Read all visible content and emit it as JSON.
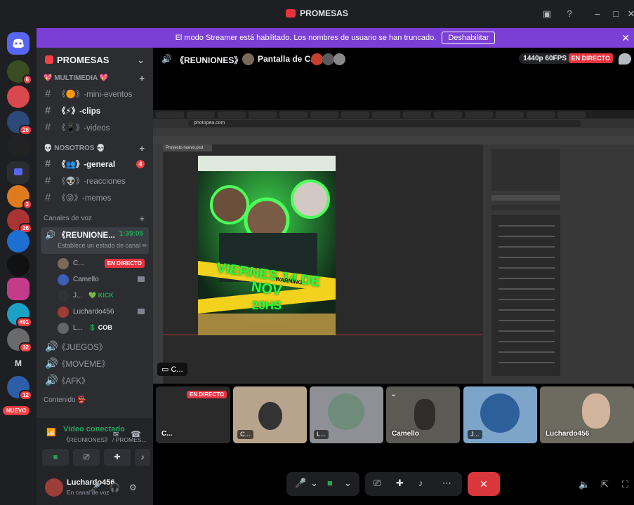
{
  "window": {
    "title": "PROMESAS"
  },
  "banner": {
    "text": "El modo Streamer está habilitado. Los nombres de usuario se han truncado.",
    "button": "Deshabilitar"
  },
  "servers": {
    "badges": [
      "6",
      "26",
      "3",
      "26",
      "491",
      "32",
      "12"
    ],
    "letter_server": "M",
    "new_label": "NUEVO"
  },
  "sidebar": {
    "guild_name": "PROMESAS",
    "categories": [
      {
        "label": "💖 MULTIMEDIA 💖",
        "channels": [
          {
            "name": "《🟠》-mini-eventos",
            "active": false
          },
          {
            "name": "《⚡》-clips",
            "active": true
          },
          {
            "name": "《📱》-videos",
            "active": false
          }
        ]
      },
      {
        "label": "💀 NOSOTROS 💀",
        "channels": [
          {
            "name": "《👥》-general",
            "active": true,
            "badge": "4"
          },
          {
            "name": "《👽》-reacciones",
            "active": false
          },
          {
            "name": "《😜》-memes",
            "active": false
          }
        ]
      }
    ],
    "voice_category": "Canales de voz",
    "voice_active": {
      "name": "《REUNIONE...",
      "time": "1:39:05",
      "status": "Establece un estado de canal ✏"
    },
    "voice_users": [
      {
        "name": "C...",
        "live": "EN DIRECTO"
      },
      {
        "name": "Camello"
      },
      {
        "name": "J...",
        "tag": "💚 KICK"
      },
      {
        "name": "Luchardo456"
      },
      {
        "name": "L...",
        "tag": "💲 COB"
      }
    ],
    "voice_channels": [
      "《JUEGOS》",
      "《MOVEME》",
      "《AFK》"
    ],
    "content_category": "Contenido 👺"
  },
  "rtc": {
    "status": "Video conectado",
    "channel": "《REUNIONES》 / PROMES...",
    "user": {
      "name": "Luchardo456",
      "status": "En canal de voz"
    }
  },
  "stage": {
    "channel": "《REUNIONES》",
    "screen_label": "Pantalla de C...",
    "quality": "1440p 60FPS",
    "live": "EN DIRECTO",
    "screen_chip": "C...",
    "url": "photopea.com",
    "doc_tab": "Proyecto nuevo.psd",
    "poster": {
      "line1": "VIERNES 14 DE NOV",
      "line2": "20HS",
      "tape": "WARNING"
    }
  },
  "tiles": [
    {
      "label": "C...",
      "live": "EN DIRECTO"
    },
    {
      "label": "C..."
    },
    {
      "label": "L..."
    },
    {
      "label": "Camello"
    },
    {
      "label": "J..."
    },
    {
      "label": "Luchardo456"
    }
  ],
  "colors": {
    "accent": "#5865f2",
    "banner": "#7c3fd6",
    "live": "#e8323f",
    "connected": "#23a55a",
    "danger": "#da373c"
  }
}
